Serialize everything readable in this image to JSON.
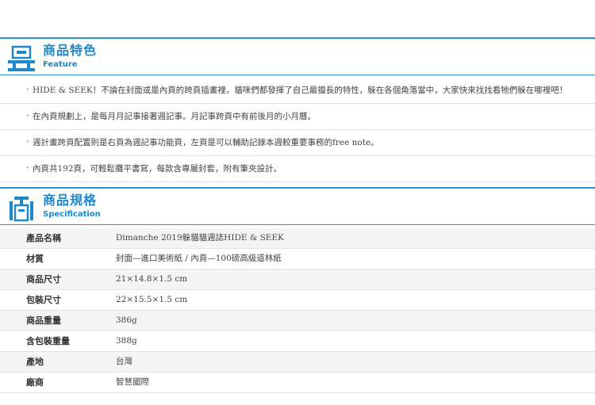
{
  "feature_section": {
    "title": "商品特色",
    "subtitle": "Feature"
  },
  "features": [
    "HIDE & SEEK！不論在封面或是內頁的跨頁插畫裡，貓咪們都發揮了自己最擅長的特性，躲在各個角落當中，大家快來找找看牠們躲在哪裡吧！",
    "在內頁規劃上，是每月月記事接著週記事。月記事跨頁中有前後月的小月曆。",
    "週計畫跨頁配置則是右頁為週記事功能頁，左頁是可以輔助記錄本週較重要事務的free note。",
    "內頁共192頁，可輕鬆攤平書寫，每款含專屬封套，附有筆夾設計。"
  ],
  "spec_section": {
    "title": "商品規格",
    "subtitle": "Specification"
  },
  "specs": [
    {
      "label": "產品名稱",
      "value": "Dimanche 2019躲貓貓週誌HIDE & SEEK"
    },
    {
      "label": "材質",
      "value": "封面—進口美術紙 / 內頁—100磅高級道林紙"
    },
    {
      "label": "商品尺寸",
      "value": "21×14.8×1.5 cm"
    },
    {
      "label": "包裝尺寸",
      "value": "22×15.5×1.5 cm"
    },
    {
      "label": "商品重量",
      "value": "386g"
    },
    {
      "label": "含包裝重量",
      "value": "388g"
    },
    {
      "label": "產地",
      "value": "台灣"
    },
    {
      "label": "廠商",
      "value": "智慧國際"
    }
  ],
  "colors": {
    "accent": "#1f88c8",
    "rule": "#2b93cf",
    "row_alt": "#f4f4f4"
  },
  "icons": {
    "feature": "product-box-icon",
    "spec": "measurement-box-icon"
  }
}
